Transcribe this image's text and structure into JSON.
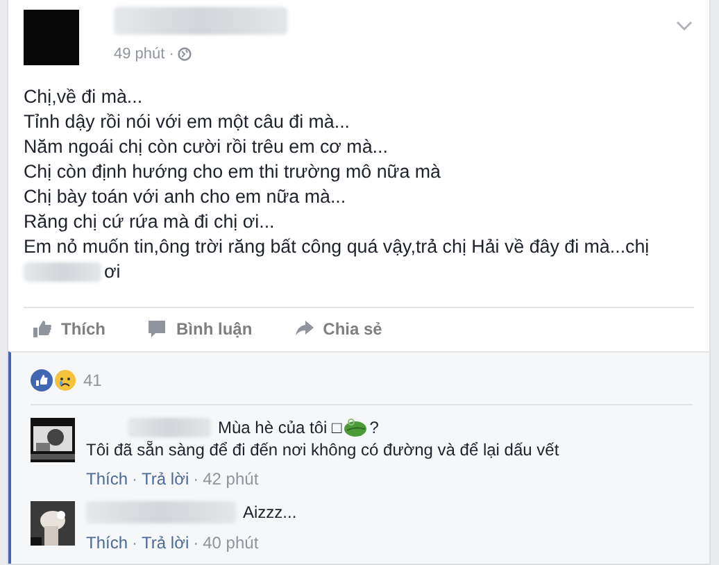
{
  "post": {
    "time": "49 phút ·",
    "lines": [
      "Chị,về đi mà...",
      "Tỉnh dậy rồi nói với em một câu đi mà...",
      "Năm ngoái chị còn cười rồi trêu em cơ mà...",
      "Chị còn định hướng cho em thi trường mô nữa mà",
      "Chị bày toán với anh cho em nữa mà...",
      "Răng chị cứ rứa mà đi chị ơi...",
      "Em nỏ muốn tin,ông trời răng bất công quá vậy,trả chị Hải về đây đi mà...chị"
    ],
    "last_line_tail": "ơi"
  },
  "actions": [
    "Thích",
    "Bình luận",
    "Chia sẻ"
  ],
  "reactions": {
    "count": "41"
  },
  "comments": [
    {
      "text": "Mùa hè của tôi □",
      "after_icon": "?",
      "second_line": "Tôi đã sẵn sàng để đi đến nơi không có đường và để lại dấu vết",
      "like": "Thích",
      "sep1": "·",
      "reply": "Trả lời",
      "sep2": "·",
      "time": "42 phút"
    },
    {
      "text": "Aizzz...",
      "like": "Thích",
      "sep1": "·",
      "reply": "Trả lời",
      "sep2": "·",
      "time": "40 phút"
    }
  ]
}
